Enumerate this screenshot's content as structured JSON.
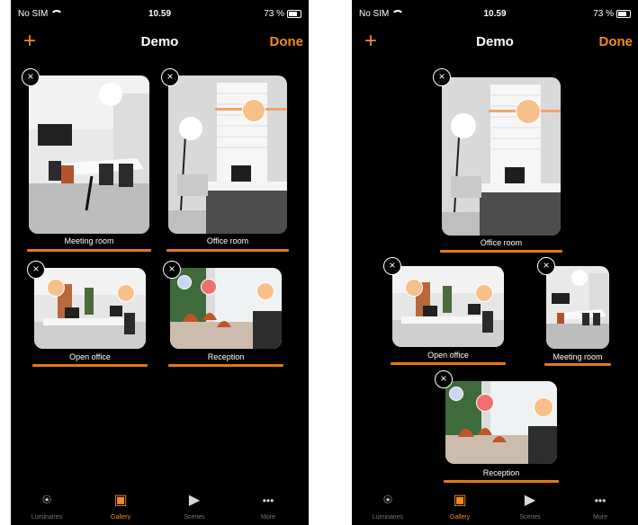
{
  "status": {
    "carrier": "No SIM",
    "time": "10.59",
    "battery": "73 %"
  },
  "nav": {
    "add_label": "+",
    "title": "Demo",
    "done_label": "Done"
  },
  "close_glyph": "×",
  "rooms": {
    "meeting_room": "Meeting room",
    "office_room": "Office room",
    "open_office": "Open office",
    "reception": "Reception"
  },
  "tabs": [
    {
      "label": "Luminaires",
      "icon": "lamp-icon",
      "glyph": "⍟"
    },
    {
      "label": "Gallery",
      "icon": "gallery-icon",
      "glyph": "▣"
    },
    {
      "label": "Scenes",
      "icon": "scenes-icon",
      "glyph": "▶"
    },
    {
      "label": "More",
      "icon": "more-icon",
      "glyph": "•••"
    }
  ],
  "colors": {
    "accent": "#f28a1e",
    "underline": "#e07a1c",
    "light_warm": "#f7c08a",
    "light_red": "#f07070",
    "light_blue": "#c9d6f5"
  }
}
